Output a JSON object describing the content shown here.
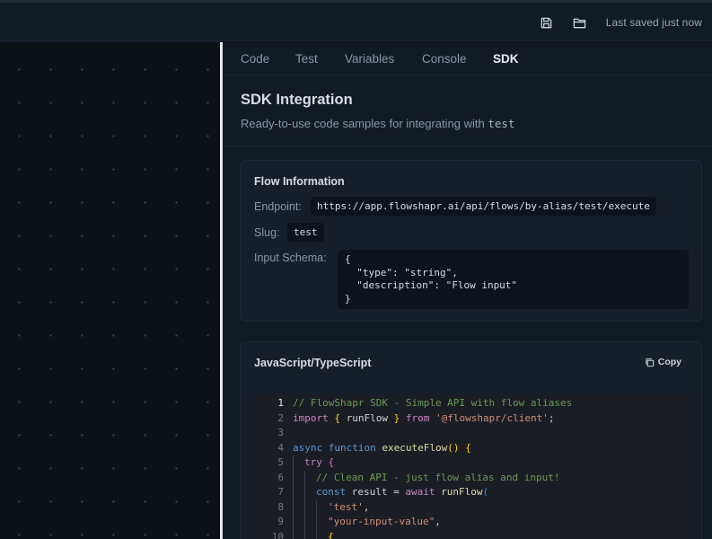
{
  "topbar": {
    "save_icon": "save-icon",
    "open_icon": "folder-icon",
    "status_text": "Last saved just now"
  },
  "tabs": [
    {
      "label": "Code",
      "active": false
    },
    {
      "label": "Test",
      "active": false
    },
    {
      "label": "Variables",
      "active": false
    },
    {
      "label": "Console",
      "active": false
    },
    {
      "label": "SDK",
      "active": true
    }
  ],
  "sdk": {
    "title": "SDK Integration",
    "subtitle_prefix": "Ready-to-use code samples for integrating with ",
    "subtitle_code": "test"
  },
  "flow_info": {
    "title": "Flow Information",
    "endpoint_label": "Endpoint:",
    "endpoint_value": "https://app.flowshapr.ai/api/flows/by-alias/test/execute",
    "slug_label": "Slug:",
    "slug_value": "test",
    "schema_label": "Input Schema:",
    "schema_lines": [
      "{",
      "  \"type\": \"string\",",
      "  \"description\": \"Flow input\"",
      "}"
    ]
  },
  "js_sample": {
    "title": "JavaScript/TypeScript",
    "copy_label": "Copy",
    "line_numbers": [
      "1",
      "2",
      "3",
      "4",
      "5",
      "6",
      "7",
      "8",
      "9",
      "10"
    ],
    "lines": {
      "l1": "// FlowShapr SDK - Simple API with flow aliases",
      "l2_kw": "import",
      "l2_ob": "{",
      "l2_id": " runFlow ",
      "l2_cb": "}",
      "l2_from": "from",
      "l2_str": "'@flowshapr/client'",
      "l2_end": ";",
      "l4_kw1": "async",
      "l4_kw2": "function",
      "l4_fn": "executeFlow",
      "l4_par": "()",
      "l4_br": "{",
      "l5_kw": "try",
      "l5_br": "{",
      "l6": "// Clean API - just flow alias and input!",
      "l7_kw": "const",
      "l7_id": " result = ",
      "l7_await": "await",
      "l7_fn": "runFlow",
      "l7_par": "(",
      "l8_str": "'test'",
      "l8_end": ",",
      "l9_str": "\"your-input-value\"",
      "l9_end": ",",
      "l10_br": "{"
    }
  }
}
